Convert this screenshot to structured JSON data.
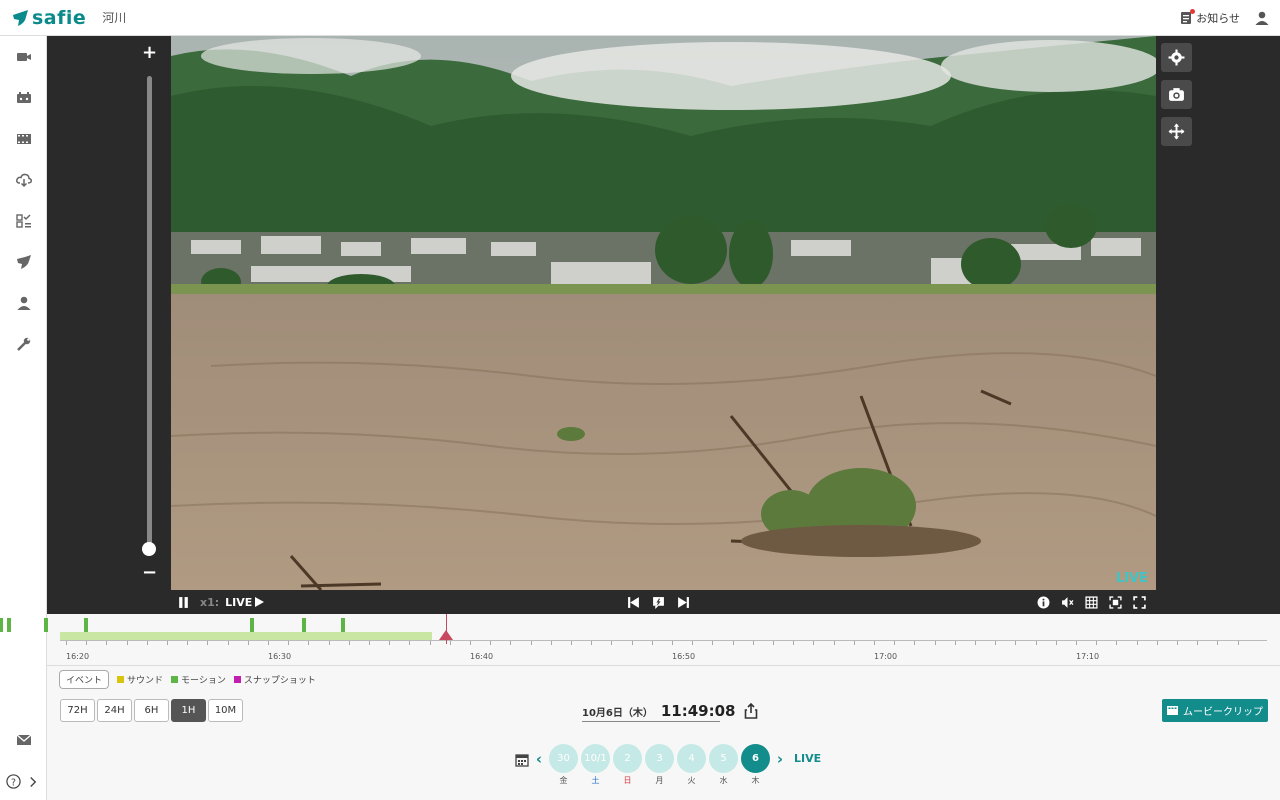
{
  "app": {
    "brand": "safie",
    "camera_name": "河川"
  },
  "header": {
    "notice_label": "お知らせ"
  },
  "sidebar": {
    "items": [
      "video-camera-icon",
      "camera-list-icon",
      "film-icon",
      "cloud-download-icon",
      "ai-icon",
      "shield-icon",
      "user-icon",
      "wrench-icon"
    ]
  },
  "video": {
    "live_badge": "LIVE",
    "zoom_plus": "+",
    "zoom_minus": "−",
    "zoom_level": 0
  },
  "controls": {
    "speed": "x1:",
    "live": "LIVE"
  },
  "timeline": {
    "ticks": [
      {
        "label": "16:20",
        "major": true
      },
      {
        "label": "16:30",
        "major": true
      },
      {
        "label": "16:40",
        "major": true
      },
      {
        "label": "16:50",
        "major": true
      },
      {
        "label": "17:00",
        "major": true
      },
      {
        "label": "17:10",
        "major": true
      }
    ],
    "event_minutes": [
      16.3,
      16.7,
      18.5,
      20.5,
      28.7,
      31.3,
      33.2
    ],
    "recorded_until_minute": 37.6,
    "cursor_minute": 38.3,
    "start_minute": 20
  },
  "legend": {
    "button": "イベント",
    "items": [
      {
        "label": "サウンド",
        "color": "#d8c40a"
      },
      {
        "label": "モーション",
        "color": "#5cb544"
      },
      {
        "label": "スナップショット",
        "color": "#c21fb0"
      }
    ]
  },
  "ranges": [
    {
      "label": "72H",
      "active": false
    },
    {
      "label": "24H",
      "active": false
    },
    {
      "label": "6H",
      "active": false
    },
    {
      "label": "1H",
      "active": true
    },
    {
      "label": "10M",
      "active": false
    }
  ],
  "current": {
    "date": "10月6日（木）",
    "time": "11:49:08"
  },
  "movie_clip_label": "ムービークリップ",
  "date_nav": {
    "days": [
      {
        "day": "30",
        "wd": "金",
        "type": "weekday",
        "active": false
      },
      {
        "day": "10/1",
        "wd": "土",
        "type": "sat",
        "active": false
      },
      {
        "day": "2",
        "wd": "日",
        "type": "sun",
        "active": false
      },
      {
        "day": "3",
        "wd": "月",
        "type": "weekday",
        "active": false
      },
      {
        "day": "4",
        "wd": "火",
        "type": "weekday",
        "active": false
      },
      {
        "day": "5",
        "wd": "水",
        "type": "weekday",
        "active": false
      },
      {
        "day": "6",
        "wd": "木",
        "type": "weekday",
        "active": true
      }
    ],
    "live": "LIVE"
  },
  "colors": {
    "brand": "#138c8c",
    "accent_light": "#c5e9e6",
    "timeline_fill": "#c9e7a2",
    "cursor": "#c8485f"
  }
}
